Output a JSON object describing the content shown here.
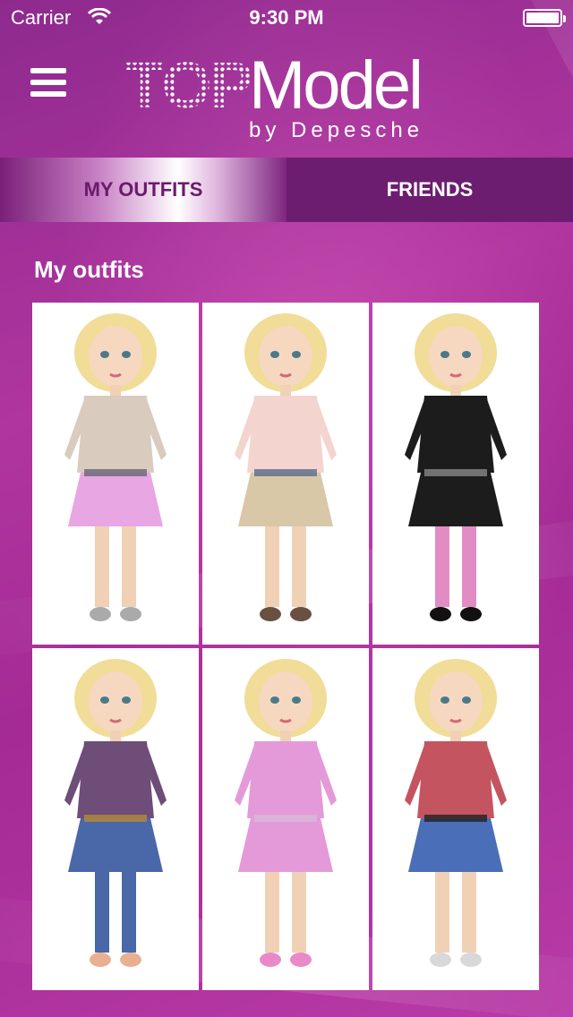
{
  "status_bar": {
    "carrier": "Carrier",
    "time": "9:30 PM",
    "wifi_icon": "wifi-icon",
    "battery_icon": "battery-icon"
  },
  "header": {
    "menu_icon": "hamburger-menu-icon",
    "logo": {
      "top": "TOP",
      "model": "Model",
      "by": "by Depesche"
    }
  },
  "tabs": [
    {
      "label": "MY OUTFITS",
      "active": true
    },
    {
      "label": "FRIENDS",
      "active": false
    }
  ],
  "section_title": "My outfits",
  "outfits": [
    {
      "name": "outfit-1",
      "top": "#d9cbbd",
      "bottom": "#e8a6e2",
      "legs": "#f1d1b6",
      "shoes": "#aaaaaa",
      "accent": "#666677"
    },
    {
      "name": "outfit-2",
      "top": "#f4d4cf",
      "bottom": "#d8c8a8",
      "legs": "#f1d1b6",
      "shoes": "#6a5040",
      "accent": "#5a6a8a"
    },
    {
      "name": "outfit-3",
      "top": "#1c1c1c",
      "bottom": "#1c1c1c",
      "legs": "#e28cc4",
      "shoes": "#111111",
      "accent": "#888888"
    },
    {
      "name": "outfit-4",
      "top": "#6e4d78",
      "bottom": "#4a67a8",
      "legs": "#4a67a8",
      "shoes": "#e8b090",
      "accent": "#b58a3a"
    },
    {
      "name": "outfit-5",
      "top": "#e49ad8",
      "bottom": "#e49ad8",
      "legs": "#f1d1b6",
      "shoes": "#e98ac8",
      "accent": "#d8b8d8"
    },
    {
      "name": "outfit-6",
      "top": "#c45560",
      "bottom": "#4a6fb8",
      "legs": "#f1d1b6",
      "shoes": "#d8d8d8",
      "accent": "#222222"
    }
  ]
}
